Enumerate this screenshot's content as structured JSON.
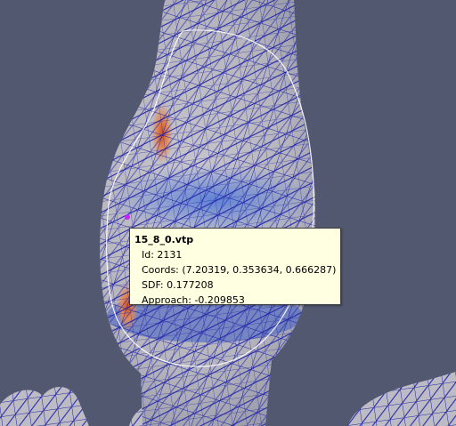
{
  "viewport": {
    "background": "#525870",
    "mesh_color": "#1f21a8",
    "surface_colors": [
      "#c4c2c9",
      "#aeb1c0",
      "#6f8fd4",
      "#d8743a"
    ],
    "selected_point_color": "#cc22ff"
  },
  "tooltip": {
    "title": "15_8_0.vtp",
    "id_label": "Id: 2131",
    "coords_label": "Coords: (7.20319, 0.353634, 0.666287)",
    "sdf_label": "SDF: 0.177208",
    "approach_label": "Approach: -0.209853"
  }
}
